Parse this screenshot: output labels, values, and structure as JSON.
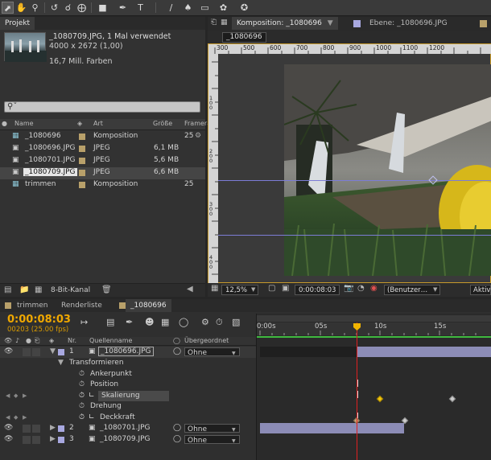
{
  "toolbar": {
    "tools": [
      "selection-tool",
      "hand-tool",
      "zoom-tool",
      "rotation-tool",
      "orbit-camera-tool",
      "pan-behind-tool",
      "rectangle-tool",
      "pen-tool",
      "type-tool",
      "brush-tool",
      "clone-stamp-tool",
      "eraser-tool",
      "roto-brush-tool",
      "puppet-pin-tool"
    ]
  },
  "project": {
    "tab_label": "Projekt",
    "item_name": "_1080709.JPG",
    "item_usage": ", 1 Mal verwendet",
    "item_dims": "4000 x 2672 (1,00)",
    "item_colors": "16,7 Mill. Farben",
    "search_placeholder": "",
    "columns": {
      "name": "Name",
      "type": "Art",
      "size": "Größe",
      "framerate": "Framera"
    },
    "items": [
      {
        "name": "_1080696",
        "type": "Komposition",
        "size": "",
        "fps": "25",
        "kind": "comp",
        "color": "#b8a06a",
        "selected": false
      },
      {
        "name": "_1080696.JPG",
        "type": "JPEG",
        "size": "6,1 MB",
        "fps": "",
        "kind": "jpg",
        "color": "#b8a06a",
        "selected": false
      },
      {
        "name": "_1080701.JPG",
        "type": "JPEG",
        "size": "5,6 MB",
        "fps": "",
        "kind": "jpg",
        "color": "#b8a06a",
        "selected": false
      },
      {
        "name": "_1080709.JPG",
        "type": "JPEG",
        "size": "6,6 MB",
        "fps": "",
        "kind": "jpg",
        "color": "#b8a06a",
        "selected": true
      },
      {
        "name": "trimmen",
        "type": "Komposition",
        "size": "",
        "fps": "25",
        "kind": "comp",
        "color": "#b8a06a",
        "selected": false
      }
    ],
    "bit_depth": "8-Bit-Kanal"
  },
  "composition": {
    "tab_label": "Komposition: _1080696",
    "layer_tab_label": "Ebene: _1080696.JPG",
    "breadcrumb": "_1080696",
    "ruler_labels": [
      "300",
      "500",
      "600",
      "700",
      "800",
      "900",
      "1000",
      "1100",
      "1200"
    ],
    "vruler_labels": [
      "100",
      "200",
      "300",
      "400",
      "500"
    ],
    "zoom": "12,5%",
    "timecode": "0:00:08:03",
    "view": "(Benutzer…",
    "active_label": "Aktiv"
  },
  "timeline": {
    "tabs": [
      "trimmen",
      "Renderliste",
      "_1080696"
    ],
    "timecode": "0:00:08:03",
    "frame_info": "00203 (25.00 fps)",
    "columns": {
      "nr": "Nr.",
      "source": "Quellenname",
      "parent": "Übergeordnet"
    },
    "ruler_labels": [
      "0:00s",
      "05s",
      "10s",
      "15s"
    ],
    "layers": [
      {
        "nr": "1",
        "name": "_1080696.JPG",
        "parent": "Ohne",
        "color": "#a8a8e0"
      },
      {
        "nr": "2",
        "name": "_1080701.JPG",
        "parent": "Ohne",
        "color": "#a8a8e0"
      },
      {
        "nr": "3",
        "name": "_1080709.JPG",
        "parent": "Ohne",
        "color": "#a8a8e0"
      }
    ],
    "group_label": "Transformieren",
    "properties": [
      "Ankerpunkt",
      "Position",
      "Skalierung",
      "Drehung",
      "Deckkraft"
    ]
  }
}
